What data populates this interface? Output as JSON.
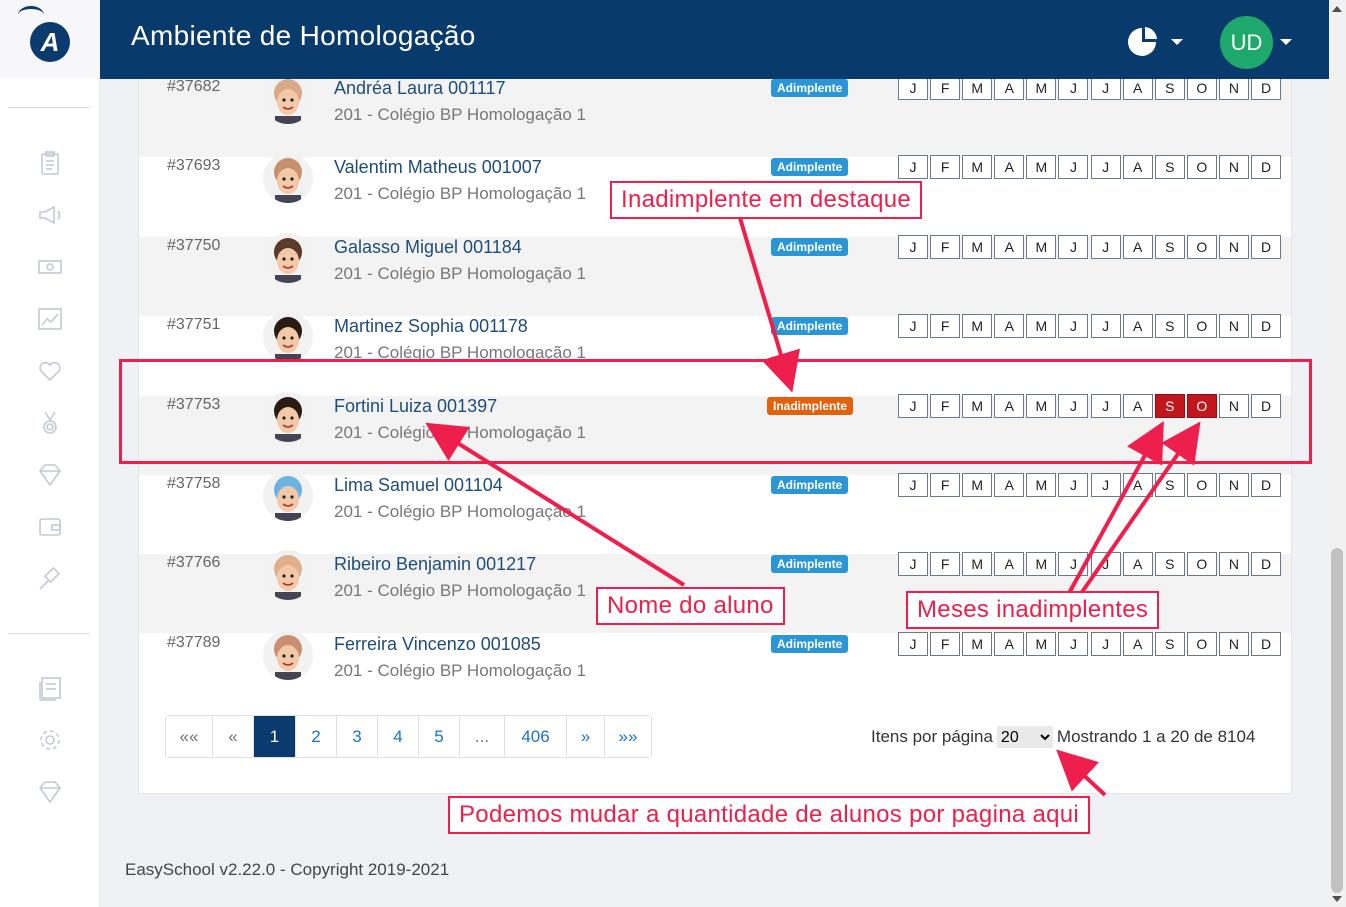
{
  "header": {
    "title": "Ambiente de Homologação",
    "user_initials": "UD"
  },
  "months": [
    "J",
    "F",
    "M",
    "A",
    "M",
    "J",
    "J",
    "A",
    "S",
    "O",
    "N",
    "D"
  ],
  "rows": [
    {
      "id": "#37682",
      "name": "Andréa Laura 001117",
      "school": "201 - Colégio BP Homologação 1",
      "status": "Adimplente"
    },
    {
      "id": "#37693",
      "name": "Valentim Matheus 001007",
      "school": "201 - Colégio BP Homologação 1",
      "status": "Adimplente"
    },
    {
      "id": "#37750",
      "name": "Galasso Miguel 001184",
      "school": "201 - Colégio BP Homologação 1",
      "status": "Adimplente"
    },
    {
      "id": "#37751",
      "name": "Martinez Sophia 001178",
      "school": "201 - Colégio BP Homologação 1",
      "status": "Adimplente"
    },
    {
      "id": "#37753",
      "name": "Fortini Luiza 001397",
      "school": "201 - Colégio BP Homologação 1",
      "status": "Inadimplente"
    },
    {
      "id": "#37758",
      "name": "Lima Samuel 001104",
      "school": "201 - Colégio BP Homologação 1",
      "status": "Adimplente"
    },
    {
      "id": "#37766",
      "name": "Ribeiro Benjamin 001217",
      "school": "201 - Colégio BP Homologação 1",
      "status": "Adimplente"
    },
    {
      "id": "#37789",
      "name": "Ferreira Vincenzo 001085",
      "school": "201 - Colégio BP Homologação 1",
      "status": "Adimplente"
    }
  ],
  "late_months_row": 4,
  "late_months": [
    8,
    9
  ],
  "pagination": {
    "first": "««",
    "prev": "«",
    "pages": [
      "1",
      "2",
      "3",
      "4",
      "5"
    ],
    "ellipsis": "...",
    "last_page": "406",
    "next": "»",
    "last": "»»"
  },
  "per_page": {
    "label": "Itens por página",
    "value": "20",
    "summary": "Mostrando 1 a 20 de 8104"
  },
  "footer": "EasySchool v2.22.0 - Copyright 2019-2021",
  "annotations": {
    "highlight": "Inadimplente em destaque",
    "student_name": "Nome do aluno",
    "late_months": "Meses inadimplentes",
    "per_page": "Podemos mudar a quantidade de alunos por pagina aqui"
  },
  "colors": {
    "header": "#083a6c",
    "annotation": "#ee1f4c",
    "badge_ok": "#2a96d6",
    "badge_bad": "#e2610c",
    "late_month": "#c0161c"
  }
}
